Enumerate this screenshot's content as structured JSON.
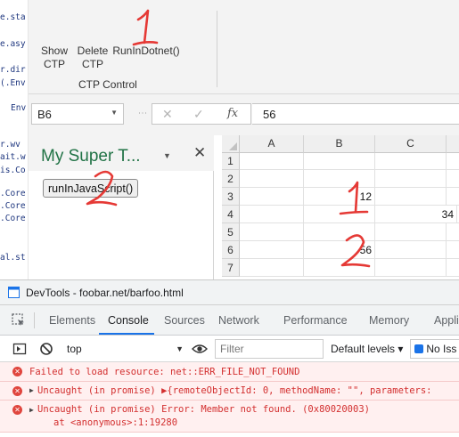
{
  "code_strip": {
    "lines": [
      "e.sta",
      "e.asy",
      "r.dir",
      "(.Env",
      "Env",
      "r.wv",
      "ait.w",
      "is.Co",
      ".Core",
      ".Core",
      ".Core",
      "al.st"
    ]
  },
  "ribbon": {
    "buttons": [
      {
        "line1": "Show",
        "line2": "CTP"
      },
      {
        "line1": "Delete",
        "line2": "CTP"
      },
      {
        "line1": "RunInDotnet()",
        "line2": ""
      }
    ],
    "group_label": "CTP Control"
  },
  "formula_bar": {
    "name_box": "B6",
    "formula_value": "56",
    "icons": [
      "cancel-icon",
      "enter-icon",
      "function-icon"
    ]
  },
  "task_pane": {
    "title": "My Super T...",
    "button_label": "runInJavaScript()"
  },
  "grid": {
    "columns": [
      "A",
      "B",
      "C"
    ],
    "rows": [
      "1",
      "2",
      "3",
      "4",
      "5",
      "6",
      "7"
    ],
    "cells": {
      "B3": "12",
      "C4": "34",
      "B6": "56"
    }
  },
  "annotations": {
    "labels": [
      "1",
      "2",
      "1",
      "2"
    ],
    "color": "#e53935"
  },
  "devtools": {
    "title": "DevTools - foobar.net/barfoo.html",
    "tabs": [
      "Elements",
      "Console",
      "Sources",
      "Network",
      "Performance",
      "Memory",
      "Appli"
    ],
    "active_tab": "Console",
    "toolbar": {
      "context": "top",
      "filter_placeholder": "Filter",
      "levels": "Default levels ▾",
      "issues": "No Iss"
    },
    "messages": [
      {
        "text": "Failed to load resource: net::ERR_FILE_NOT_FOUND",
        "expandable": false
      },
      {
        "text": "Uncaught (in promise) ▶{remoteObjectId: 0, methodName: \"\", parameters:",
        "expandable": true
      },
      {
        "text": "Uncaught (in promise) Error: Member not found. (0x80020003)",
        "second_line": "at <anonymous>:1:19280",
        "expandable": true
      }
    ]
  },
  "colors": {
    "excel_green": "#217346",
    "error_red": "#d32f2f",
    "error_bg": "#fff0f0",
    "devtools_blue": "#1a73e8"
  }
}
